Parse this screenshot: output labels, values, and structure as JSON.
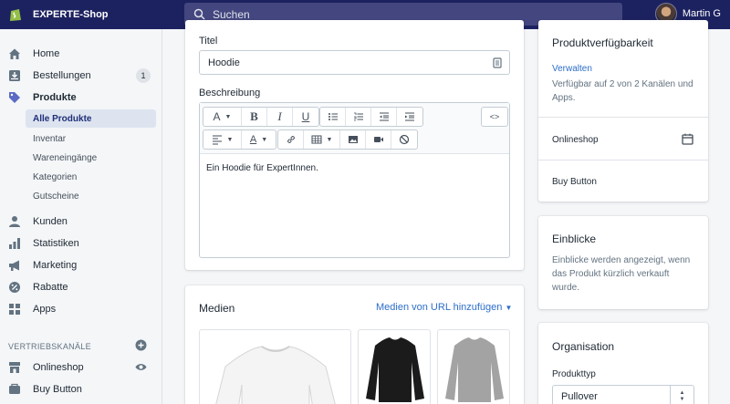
{
  "topbar": {
    "shop_name": "EXPERTE-Shop",
    "search_placeholder": "Suchen",
    "user_name": "Martin G"
  },
  "sidebar": {
    "items": [
      {
        "label": "Home",
        "icon": "home-icon"
      },
      {
        "label": "Bestellungen",
        "icon": "orders-icon",
        "badge": "1"
      },
      {
        "label": "Produkte",
        "icon": "tag-icon"
      }
    ],
    "sub_items": [
      {
        "label": "Alle Produkte",
        "active": true
      },
      {
        "label": "Inventar"
      },
      {
        "label": "Wareneingänge"
      },
      {
        "label": "Kategorien"
      },
      {
        "label": "Gutscheine"
      }
    ],
    "items2": [
      {
        "label": "Kunden",
        "icon": "person-icon"
      },
      {
        "label": "Statistiken",
        "icon": "bar-chart-icon"
      },
      {
        "label": "Marketing",
        "icon": "megaphone-icon"
      },
      {
        "label": "Rabatte",
        "icon": "discount-icon"
      },
      {
        "label": "Apps",
        "icon": "apps-icon"
      }
    ],
    "channels_heading": "VERTRIEBSKANÄLE",
    "channels": [
      {
        "label": "Onlineshop",
        "icon": "store-icon"
      },
      {
        "label": "Buy Button",
        "icon": "buy-button-icon"
      }
    ]
  },
  "product": {
    "title_label": "Titel",
    "title_value": "Hoodie",
    "description_label": "Beschreibung",
    "description_value": "Ein Hoodie für ExpertInnen."
  },
  "media": {
    "heading": "Medien",
    "add_from_url": "Medien von URL hinzufügen"
  },
  "availability": {
    "heading": "Produktverfügbarkeit",
    "manage_link": "Verwalten",
    "summary": "Verfügbar auf 2 von 2 Kanälen und Apps.",
    "channels": [
      "Onlineshop",
      "Buy Button"
    ]
  },
  "insights": {
    "heading": "Einblicke",
    "text": "Einblicke werden angezeigt, wenn das Produkt kürzlich verkauft wurde."
  },
  "organisation": {
    "heading": "Organisation",
    "product_type_label": "Produkttyp",
    "product_type_value": "Pullover"
  },
  "colors": {
    "topbar": "#1c2260",
    "accent": "#2c6ecb",
    "shopify_green": "#95bf47"
  }
}
